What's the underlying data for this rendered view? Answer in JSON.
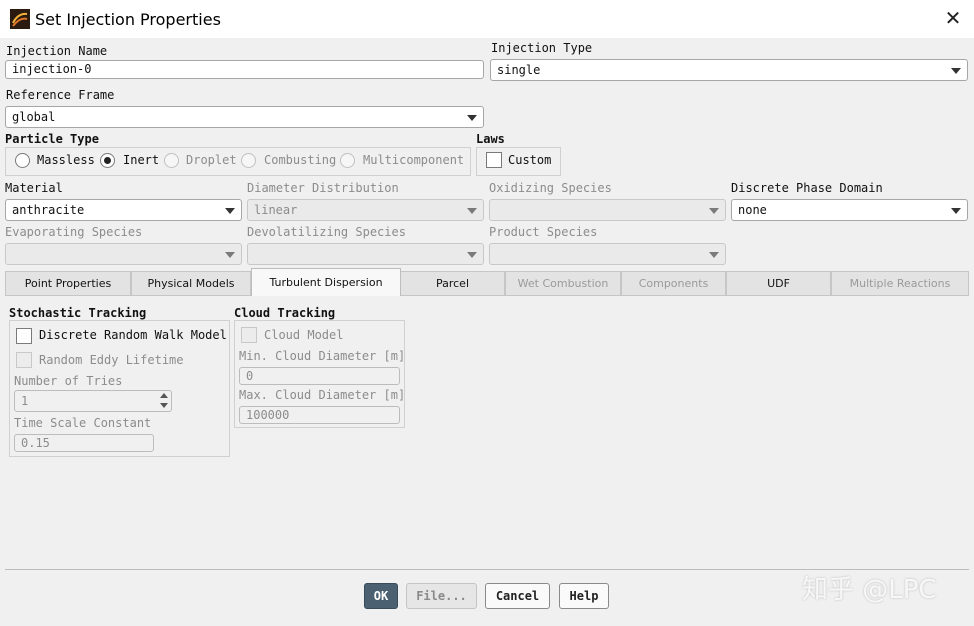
{
  "window": {
    "title": "Set Injection Properties"
  },
  "injection_name": {
    "label": "Injection Name",
    "value": "injection-0"
  },
  "injection_type": {
    "label": "Injection Type",
    "value": "single"
  },
  "reference_frame": {
    "label": "Reference Frame",
    "value": "global"
  },
  "particle_type": {
    "label": "Particle Type",
    "options": [
      {
        "label": "Massless",
        "selected": false,
        "enabled": true
      },
      {
        "label": "Inert",
        "selected": true,
        "enabled": true
      },
      {
        "label": "Droplet",
        "selected": false,
        "enabled": false
      },
      {
        "label": "Combusting",
        "selected": false,
        "enabled": false
      },
      {
        "label": "Multicomponent",
        "selected": false,
        "enabled": false
      }
    ]
  },
  "laws": {
    "label": "Laws",
    "custom_label": "Custom",
    "custom_checked": false
  },
  "material": {
    "label": "Material",
    "value": "anthracite"
  },
  "diameter_distribution": {
    "label": "Diameter Distribution",
    "value": "linear"
  },
  "oxidizing_species": {
    "label": "Oxidizing Species",
    "value": ""
  },
  "discrete_phase_domain": {
    "label": "Discrete Phase Domain",
    "value": "none"
  },
  "evaporating_species": {
    "label": "Evaporating Species",
    "value": ""
  },
  "devolatilizing_species": {
    "label": "Devolatilizing Species",
    "value": ""
  },
  "product_species": {
    "label": "Product Species",
    "value": ""
  },
  "tabs": [
    {
      "label": "Point Properties",
      "active": false,
      "enabled": true
    },
    {
      "label": "Physical Models",
      "active": false,
      "enabled": true
    },
    {
      "label": "Turbulent Dispersion",
      "active": true,
      "enabled": true
    },
    {
      "label": "Parcel",
      "active": false,
      "enabled": true
    },
    {
      "label": "Wet Combustion",
      "active": false,
      "enabled": false
    },
    {
      "label": "Components",
      "active": false,
      "enabled": false
    },
    {
      "label": "UDF",
      "active": false,
      "enabled": true
    },
    {
      "label": "Multiple Reactions",
      "active": false,
      "enabled": false
    }
  ],
  "stochastic_tracking": {
    "title": "Stochastic Tracking",
    "discrete_random_walk_label": "Discrete Random Walk Model",
    "discrete_random_walk_checked": false,
    "random_eddy_lifetime_label": "Random Eddy Lifetime",
    "number_of_tries_label": "Number of Tries",
    "number_of_tries_value": "1",
    "time_scale_constant_label": "Time Scale Constant",
    "time_scale_constant_value": "0.15"
  },
  "cloud_tracking": {
    "title": "Cloud Tracking",
    "cloud_model_label": "Cloud Model",
    "min_diameter_label": "Min. Cloud Diameter [m]",
    "min_diameter_value": "0",
    "max_diameter_label": "Max. Cloud Diameter [m]",
    "max_diameter_value": "100000"
  },
  "buttons": {
    "ok": "OK",
    "file": "File...",
    "cancel": "Cancel",
    "help": "Help"
  },
  "watermark": "知乎 @LPC",
  "colors": {
    "primary_button": "#4b6172",
    "dialog_bg": "#f0f0f0"
  }
}
